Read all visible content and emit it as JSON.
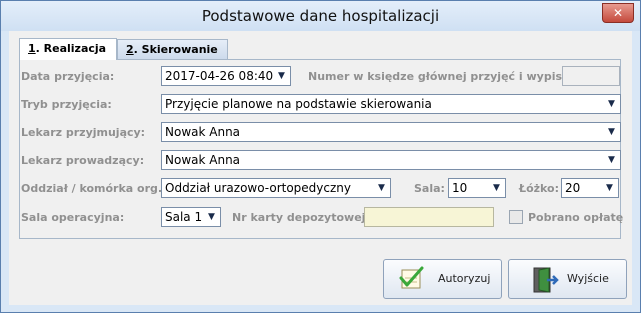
{
  "window": {
    "title": "Podstawowe dane hospitalizacji",
    "close_glyph": "✕"
  },
  "tabs": [
    {
      "key": "1",
      "rest": ". Realizacja"
    },
    {
      "key": "2",
      "rest": ". Skierowanie"
    }
  ],
  "form": {
    "data_przyjecia_label": "Data przyjęcia:",
    "data_przyjecia_value": "2017-04-26 08:40",
    "numer_label": "Numer w księdze głównej przyjęć i wypisów:",
    "numer_value": "",
    "tryb_label": "Tryb przyjęcia:",
    "tryb_value": "Przyjęcie planowe na podstawie skierowania",
    "lekarz_przyjmujacy_label": "Lekarz przyjmujący:",
    "lekarz_przyjmujacy_value": "Nowak Anna",
    "lekarz_prowadzacy_label": "Lekarz prowadzący:",
    "lekarz_prowadzacy_value": "Nowak Anna",
    "oddzial_label": "Oddział / komórka org.:",
    "oddzial_value": "Oddział urazowo-ortopedyczny",
    "sala_label": "Sala:",
    "sala_value": "10",
    "lozko_label": "Łóżko:",
    "lozko_value": "20",
    "sala_operacyjna_label": "Sala operacyjna:",
    "sala_operacyjna_value": "Sala 1",
    "nr_karty_label": "Nr karty depozytowej:",
    "nr_karty_value": "",
    "pobrano_label": "Pobrano opłatę",
    "pobrano_checked": false,
    "dropdown_glyph": "▼"
  },
  "buttons": {
    "autoryzuj": "Autoryzuj",
    "wyjscie": "Wyjście"
  },
  "icons": {
    "autoryzuj": "check-document-icon",
    "wyjscie": "exit-door-icon"
  }
}
